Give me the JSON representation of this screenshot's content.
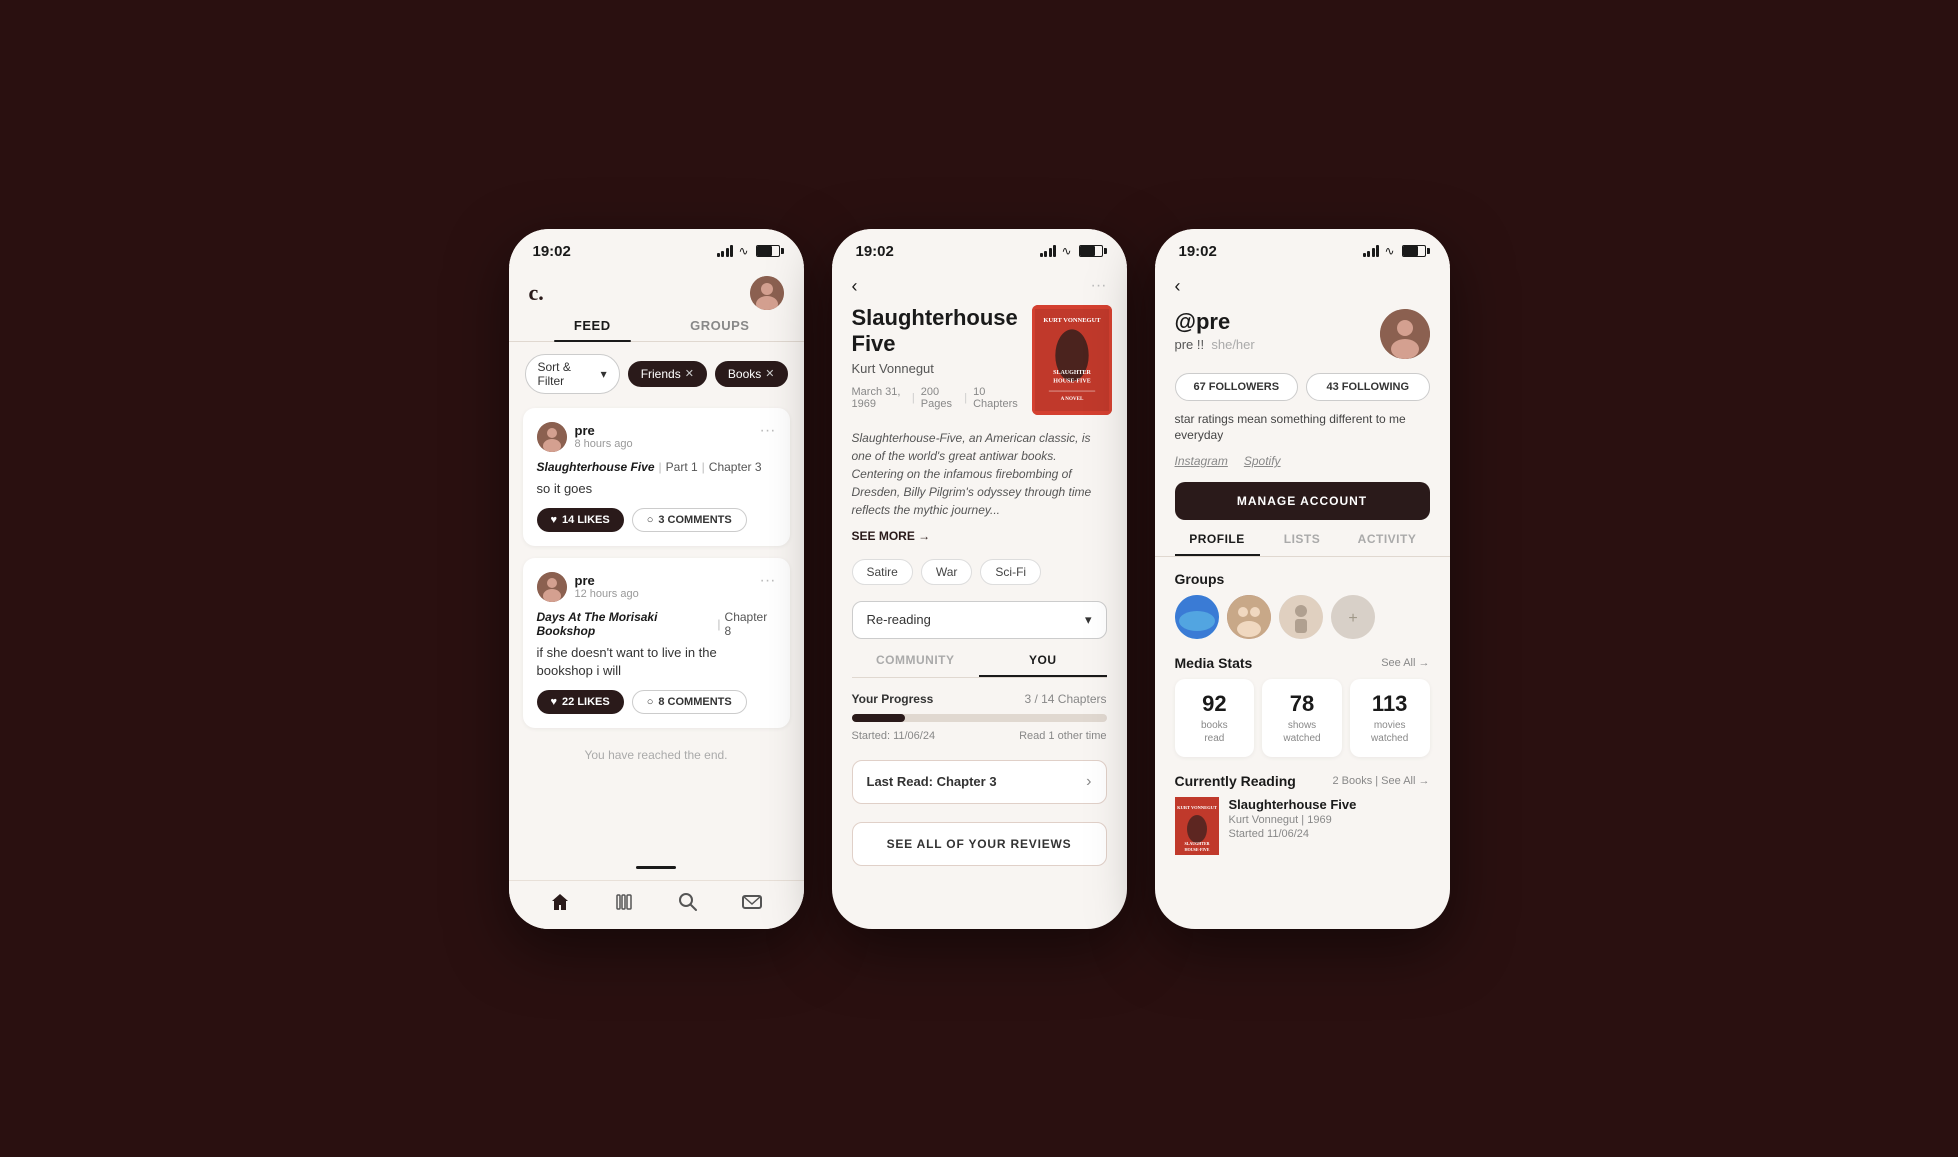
{
  "app": {
    "logo": "c.",
    "time": "19:02"
  },
  "screen1": {
    "title": "Feed Screen",
    "tabs": [
      {
        "label": "FEED",
        "active": true
      },
      {
        "label": "GROUPS",
        "active": false
      }
    ],
    "filters": [
      {
        "label": "Sort & Filter",
        "type": "outline"
      },
      {
        "label": "Friends",
        "type": "dark"
      },
      {
        "label": "Books",
        "type": "dark"
      }
    ],
    "posts": [
      {
        "username": "pre",
        "time": "8 hours ago",
        "book": "Slaughterhouse Five",
        "part": "Part 1",
        "chapter": "Chapter 3",
        "text": "so it goes",
        "likes": "14 LIKES",
        "comments": "3 COMMENTS"
      },
      {
        "username": "pre",
        "time": "12 hours ago",
        "book": "Days At The Morisaki Bookshop",
        "part": null,
        "chapter": "Chapter 8",
        "text": "if she doesn't want to live in the bookshop i will",
        "likes": "22 LIKES",
        "comments": "8 COMMENTS"
      }
    ],
    "end_text": "You have reached the end.",
    "nav": [
      {
        "icon": "home",
        "label": "home",
        "active": true
      },
      {
        "icon": "library",
        "label": "library"
      },
      {
        "icon": "search",
        "label": "search"
      },
      {
        "icon": "mail",
        "label": "mail"
      }
    ]
  },
  "screen2": {
    "title": "Book Detail Screen",
    "book": {
      "title": "Slaughterhouse Five",
      "author": "Kurt Vonnegut",
      "date": "March 31, 1969",
      "pages": "200 Pages",
      "chapters": "10 Chapters",
      "description": "Slaughterhouse-Five, an American classic, is one of the world's great antiwar books. Centering on the infamous firebombing of Dresden, Billy Pilgrim's odyssey through time reflects the mythic journey...",
      "see_more": "SEE MORE →",
      "genres": [
        "Satire",
        "War",
        "Sci-Fi"
      ],
      "reading_status": "Re-reading"
    },
    "tabs": [
      {
        "label": "COMMUNITY",
        "active": false
      },
      {
        "label": "YOU",
        "active": true
      }
    ],
    "progress": {
      "label": "Your Progress",
      "current": 3,
      "total": 14,
      "unit": "Chapters",
      "percent": 21,
      "started": "Started: 11/06/24",
      "read_other_times": "Read 1 other time"
    },
    "last_read": {
      "label": "Last Read:",
      "chapter": "Chapter 3"
    },
    "see_all_reviews": "SEE ALL OF YOUR REVIEWS"
  },
  "screen3": {
    "title": "Profile Screen",
    "user": {
      "handle": "@pre",
      "display_name": "pre !!",
      "pronouns": "she/her",
      "bio": "star ratings mean something different to me everyday",
      "instagram": "Instagram",
      "spotify": "Spotify"
    },
    "followers": {
      "count": "67 FOLLOWERS",
      "following": "43 FOLLOWING"
    },
    "manage_btn": "MANAGE ACCOUNT",
    "tabs": [
      {
        "label": "PROFILE",
        "active": true
      },
      {
        "label": "LISTS",
        "active": false
      },
      {
        "label": "ACTIVITY",
        "active": false
      }
    ],
    "groups": {
      "label": "Groups",
      "items": [
        {
          "type": "ocean"
        },
        {
          "type": "people"
        },
        {
          "type": "figure"
        },
        {
          "type": "placeholder"
        }
      ]
    },
    "media_stats": {
      "label": "Media Stats",
      "see_all": "See All →",
      "stats": [
        {
          "number": "92",
          "label": "books\nread"
        },
        {
          "number": "78",
          "label": "shows\nwatched"
        },
        {
          "number": "113",
          "label": "movies\nwatched"
        }
      ]
    },
    "currently_reading": {
      "label": "Currently Reading",
      "link": "2 Books | See All →",
      "book": {
        "title": "Slaughterhouse Five",
        "author": "Kurt Vonnegut",
        "year": "1969",
        "started": "Started 11/06/24"
      }
    }
  }
}
